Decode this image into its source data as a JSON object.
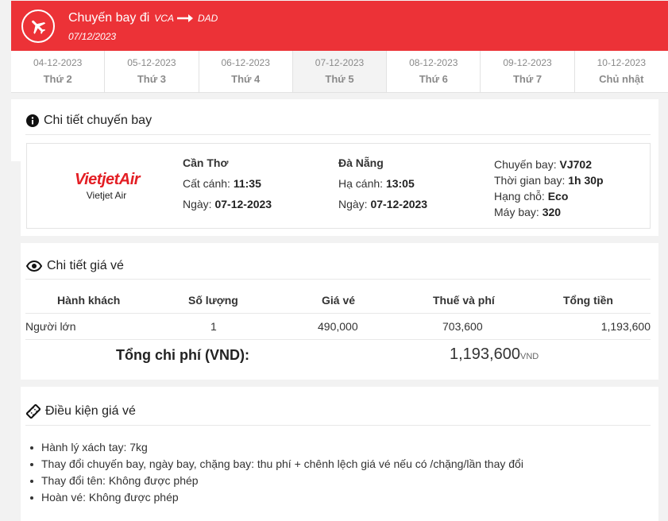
{
  "header": {
    "title": "Chuyến bay đi",
    "from": "VCA",
    "to": "DAD",
    "date": "07/12/2023",
    "color": "#ec3237"
  },
  "tabs": [
    {
      "date": "04-12-2023",
      "weekday": "Thứ 2",
      "active": false
    },
    {
      "date": "05-12-2023",
      "weekday": "Thứ 3",
      "active": false
    },
    {
      "date": "06-12-2023",
      "weekday": "Thứ 4",
      "active": false
    },
    {
      "date": "07-12-2023",
      "weekday": "Thứ 5",
      "active": true
    },
    {
      "date": "08-12-2023",
      "weekday": "Thứ 6",
      "active": false
    },
    {
      "date": "09-12-2023",
      "weekday": "Thứ 7",
      "active": false
    },
    {
      "date": "10-12-2023",
      "weekday": "Chủ nhật",
      "active": false
    }
  ],
  "flight_detail": {
    "title": "Chi tiết chuyến bay",
    "airline_logo": "VietjetAir",
    "airline_name": "Vietjet Air",
    "departure": {
      "city": "Cần Thơ",
      "time_label": "Cất cánh:",
      "time": "11:35",
      "date_label": "Ngày:",
      "date": "07-12-2023"
    },
    "arrival": {
      "city": "Đà Nẵng",
      "time_label": "Hạ cánh:",
      "time": "13:05",
      "date_label": "Ngày:",
      "date": "07-12-2023"
    },
    "info": {
      "flight_label": "Chuyến bay:",
      "flight": "VJ702",
      "duration_label": "Thời gian bay:",
      "duration": "1h 30p",
      "class_label": "Hạng chỗ:",
      "class": "Eco",
      "aircraft_label": "Máy bay:",
      "aircraft": "320"
    }
  },
  "price_detail": {
    "title": "Chi tiết giá vé",
    "headers": {
      "passenger": "Hành khách",
      "quantity": "Số lượng",
      "fare": "Giá vé",
      "tax": "Thuế và phí",
      "total": "Tổng tiền"
    },
    "row": {
      "passenger": "Người lớn",
      "quantity": "1",
      "fare": "490,000",
      "tax": "703,600",
      "total": "1,193,600"
    },
    "total_label": "Tổng chi phí (VND):",
    "total_value": "1,193,600",
    "total_currency": "VND"
  },
  "conditions": {
    "title": "Điều kiện giá vé",
    "items": [
      "Hành lý xách tay: 7kg",
      "Thay đổi chuyến bay, ngày bay, chặng bay: thu phí + chênh lệch giá vé nếu có /chặng/lần thay đổi",
      "Thay đổi tên: Không được phép",
      "Hoàn vé: Không được phép"
    ]
  }
}
